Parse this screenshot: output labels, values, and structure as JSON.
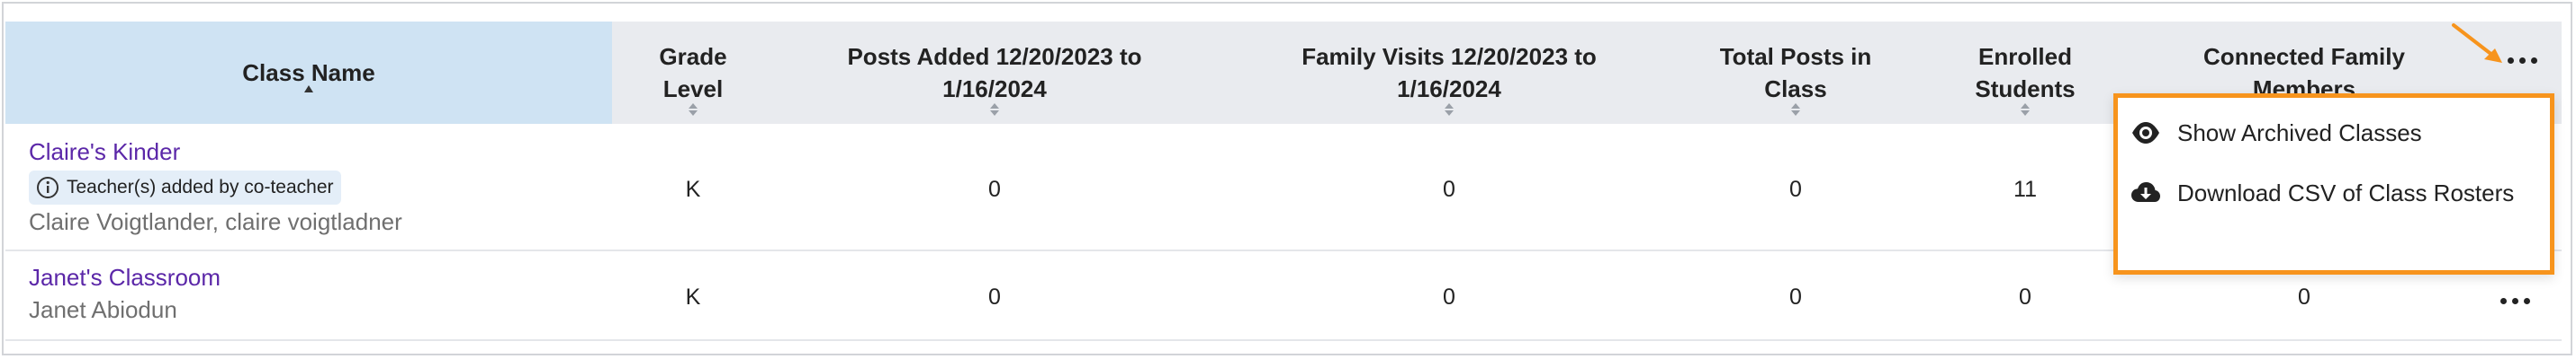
{
  "table": {
    "columns": [
      {
        "label": "Class Name"
      },
      {
        "label": "Grade Level"
      },
      {
        "label": "Posts Added 12/20/2023 to 1/16/2024"
      },
      {
        "label": "Family Visits 12/20/2023 to 1/16/2024"
      },
      {
        "label": "Total Posts in Class"
      },
      {
        "label": "Enrolled Students"
      },
      {
        "label": "Connected Family Members"
      }
    ],
    "rows": [
      {
        "name": "Claire's Kinder",
        "badge": "Teacher(s) added by co-teacher",
        "teachers": "Claire Voigtlander, claire voigtladner",
        "grade": "K",
        "posts_added": "0",
        "family_visits": "0",
        "total_posts": "0",
        "enrolled": "11"
      },
      {
        "name": "Janet's Classroom",
        "teachers": "Janet Abiodun",
        "grade": "K",
        "posts_added": "0",
        "family_visits": "0",
        "total_posts": "0",
        "enrolled": "0",
        "connected": "0"
      }
    ]
  },
  "menu": {
    "items": [
      {
        "label": "Show Archived Classes",
        "icon": "eye-icon"
      },
      {
        "label": "Download CSV of Class Rosters",
        "icon": "cloud-download-icon"
      }
    ]
  },
  "colors": {
    "accent_orange": "#f7941d",
    "link_purple": "#5b27a8",
    "header_bg": "#e9ebef",
    "sorted_header_bg": "#cfe3f3"
  }
}
